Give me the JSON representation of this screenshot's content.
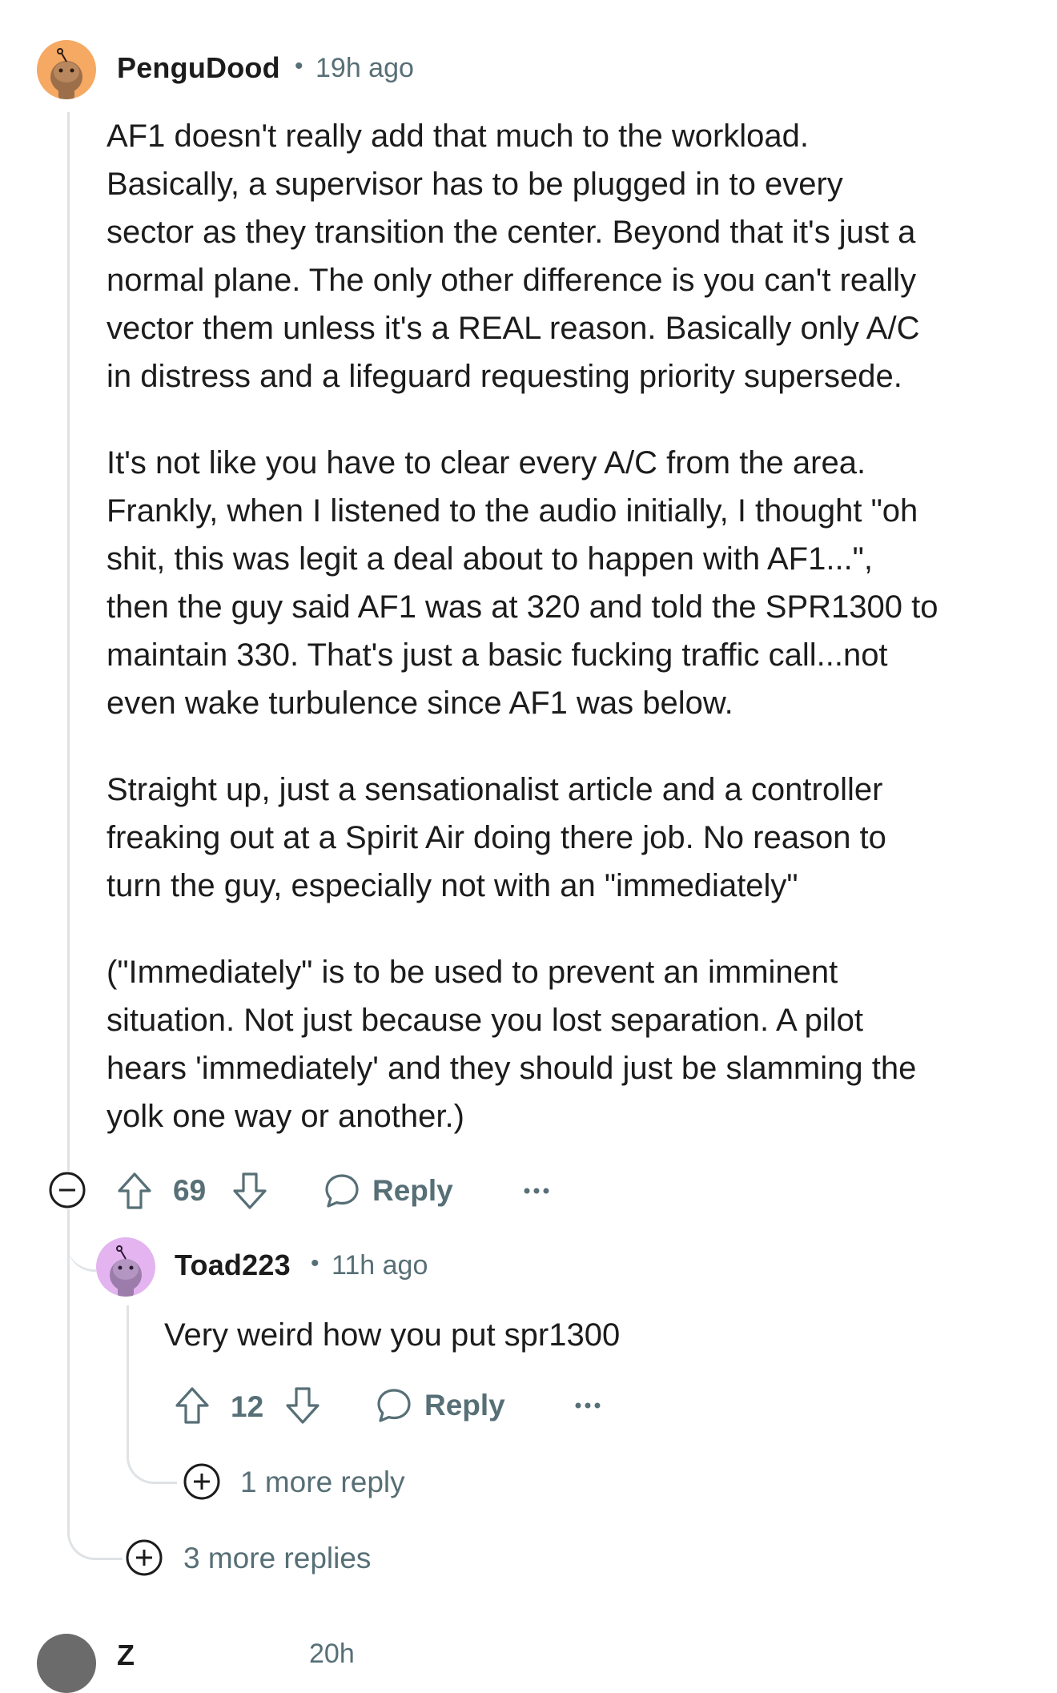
{
  "comment": {
    "author": "PenguDood",
    "separator": "•",
    "time": "19h ago",
    "paragraphs": [
      "AF1 doesn't really add that much to the workload.\nBasically, a supervisor has to be plugged in to every\nsector as they transition the center. Beyond that it's just a\nnormal plane. The only other difference is you can't really\nvector them unless it's a REAL reason. Basically only A/C\nin distress and a lifeguard requesting priority supersede.",
      "It's not like you have to clear every A/C from the area.\nFrankly, when I listened to the audio initially, I thought \"oh\nshit, this was legit a deal about to happen with AF1...\",\nthen the guy said AF1 was at 320 and told the SPR1300 to\nmaintain 330. That's just a basic fucking traffic call...not\neven wake turbulence since AF1 was below.",
      "Straight up, just a sensationalist article and a controller\nfreaking out at a Spirit Air doing there job. No reason to\nturn the guy, especially not with an \"immediately\"",
      "(\"Immediately\" is to be used to prevent an imminent\nsituation. Not just because you lost separation. A pilot\nhears 'immediately' and they should just be slamming the\nyolk one way or another.)"
    ],
    "votes": "69",
    "reply_label": "Reply",
    "more_replies": "3 more replies",
    "avatar_color": "#f5a963"
  },
  "reply": {
    "author": "Toad223",
    "separator": "•",
    "time": "11h ago",
    "text": "Very weird how you put spr1300",
    "votes": "12",
    "reply_label": "Reply",
    "more_replies": "1 more reply",
    "avatar_color": "#e3b4f0"
  },
  "next_comment": {
    "partial_author": "Z",
    "partial_time": "20h"
  },
  "colors": {
    "meta_gray": "#576f76",
    "thread_line": "#dfe3e6",
    "text": "#1c1c1c"
  }
}
